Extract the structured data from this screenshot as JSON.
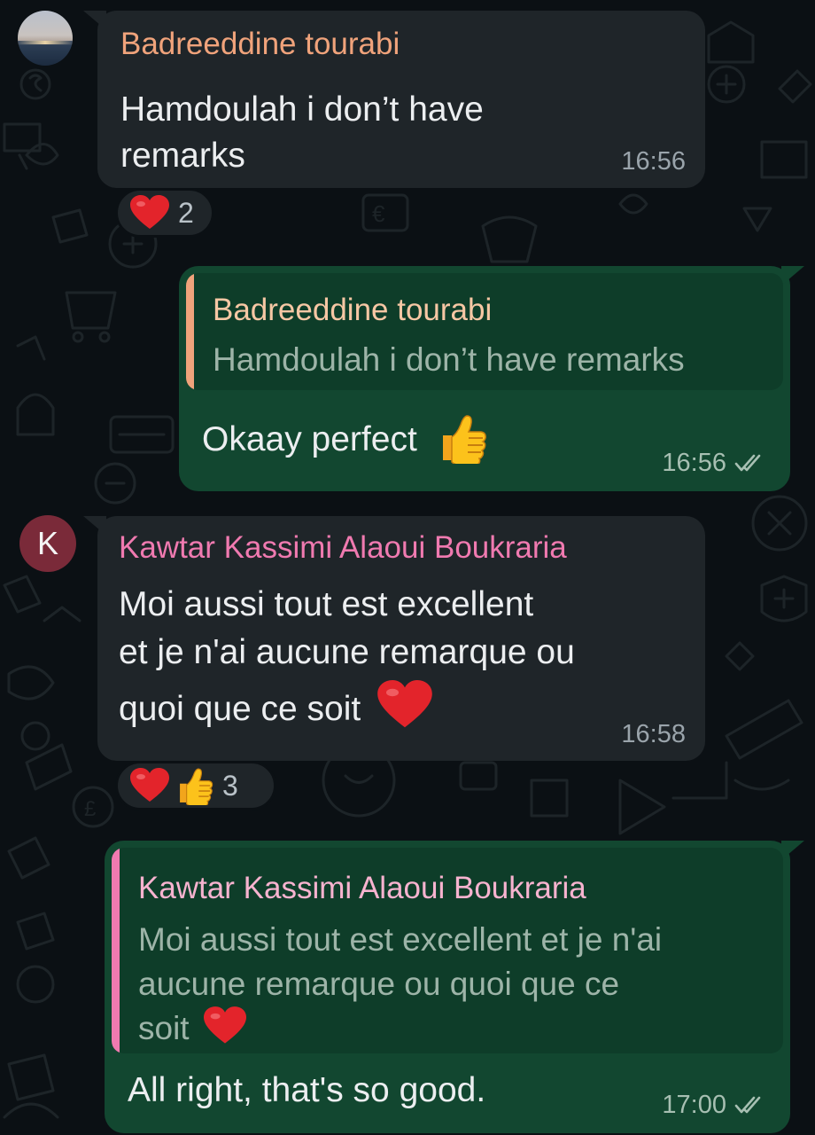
{
  "colors": {
    "background": "#0b1014",
    "incoming_bubble": "#1f2529",
    "outgoing_bubble": "#124730",
    "quote_box": "#0e3d29",
    "sender_badreeddine": "#f0a37b",
    "sender_kawtar": "#f07ab0",
    "quote_sender_badreeddine": "#f6c7a4",
    "quote_sender_kawtar": "#f7b3cf",
    "avatar_k": "#7a2a39",
    "read_ticks": "#a7bfb2"
  },
  "messages": [
    {
      "direction": "incoming",
      "sender": "Badreeddine tourabi",
      "lines": [
        "Hamdoulah i don’t have",
        "remarks"
      ],
      "time": "16:56",
      "reactions": {
        "emojis": [
          "heart"
        ],
        "count": "2"
      }
    },
    {
      "direction": "outgoing",
      "quote": {
        "sender": "Badreeddine tourabi",
        "lines": [
          "Hamdoulah i don’t have remarks"
        ]
      },
      "text": "Okaay perfect",
      "emoji": "thumbs-up",
      "time": "16:56",
      "status_icon": "double-check-icon"
    },
    {
      "direction": "incoming",
      "avatar_letter": "K",
      "sender": "Kawtar Kassimi Alaoui Boukraria",
      "lines": [
        "Moi aussi tout est excellent",
        "et je n'ai aucune remarque ou",
        "quoi que ce soit"
      ],
      "emoji": "heart",
      "time": "16:58",
      "reactions": {
        "emojis": [
          "heart",
          "thumbs-up"
        ],
        "count": "3"
      }
    },
    {
      "direction": "outgoing",
      "quote": {
        "sender": "Kawtar Kassimi Alaoui Boukraria",
        "lines": [
          "Moi aussi tout est excellent et je n'ai",
          "aucune remarque ou quoi que ce",
          "soit"
        ],
        "emoji": "heart"
      },
      "text": "All right, that's so good.",
      "time": "17:00",
      "status_icon": "double-check-icon"
    }
  ]
}
